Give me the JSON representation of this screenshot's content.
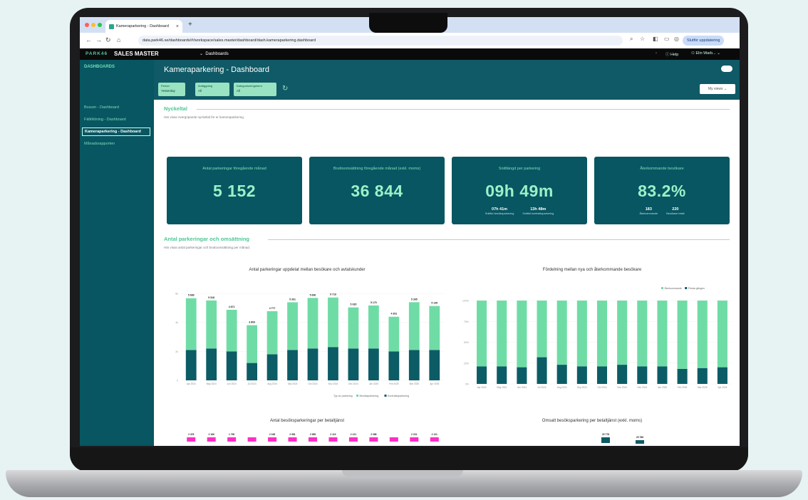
{
  "browser": {
    "tab_title": "Kameraparkering - Dashboard",
    "tab_close": "×",
    "new_tab": "+",
    "url": "data.park46.se/dashboards/#/workspace/sales.master/dashboard/dash.kameraparkering.dashboard",
    "update_button": "Slutför uppdatering"
  },
  "app": {
    "brand": "PARK46",
    "name": "SALES MASTER",
    "dashboards_menu": "Dashboards",
    "help": "Help",
    "user": "Elin Warb..."
  },
  "sidebar": {
    "header": "DASHBOARDS",
    "items": [
      {
        "label": "Bosum - Dashboard"
      },
      {
        "label": "Fältöktning - Dashboard"
      },
      {
        "label": "Kameraparkering - Dashboard"
      },
      {
        "label": "Månadsrapporten"
      }
    ]
  },
  "page": {
    "title": "Kameraparkering - Dashboard",
    "filters": [
      {
        "label": "Period",
        "value": "Yesterday"
      },
      {
        "label": "Anläggning",
        "value": "All"
      },
      {
        "label": "Kategoriseringsform",
        "value": "All"
      }
    ],
    "filter_right": "My views"
  },
  "section1": {
    "title": "Nyckeltal",
    "desc": "Här visas övergripande nyckeltal för er kameraparkering."
  },
  "kpis": [
    {
      "label": "Antal parkeringar föregående månad",
      "value": "5 152",
      "subs": []
    },
    {
      "label": "Bruttoomsättning föregående månad (exkl. moms)",
      "value": "36 844",
      "subs": []
    },
    {
      "label": "Snittlängd per parkering",
      "value": "09h 49m",
      "subs": [
        {
          "value": "07h 41m",
          "label": "Snitttid besöksparkering"
        },
        {
          "value": "13h 48m",
          "label": "Snitttid kontraktsparkering"
        }
      ]
    },
    {
      "label": "Återkommande besökare",
      "value": "83.2%",
      "subs": [
        {
          "value": "183",
          "label": "Återkommande"
        },
        {
          "value": "220",
          "label": "Besökare totalt"
        }
      ]
    }
  ],
  "section2": {
    "title": "Antal parkeringar och omsättning",
    "desc": "Här visas antal parkeringar och bruttoomsättning per månad."
  },
  "chart_data": [
    {
      "type": "bar",
      "title": "Antal parkeringar uppdelat mellan besökare och avtalskunder",
      "categories": [
        "Apr 2024",
        "May 2024",
        "Jun 2024",
        "Jul 2024",
        "Aug 2024",
        "Sep 2024",
        "Oct 2024",
        "Nov 2024",
        "Dec 2024",
        "Jan 2025",
        "Feb 2025",
        "Mar 2025",
        "Apr 2025"
      ],
      "total_labels": [
        "5 669",
        "5 518",
        "4 871",
        "3 809",
        "4 777",
        "5 391",
        "5 690",
        "5 719",
        "5 035",
        "5 170",
        "4 391",
        "5 395",
        "5 135"
      ],
      "series": [
        {
          "name": "Besöksparkering",
          "color": "#6fdca6",
          "values": [
            3569,
            3318,
            2871,
            2609,
            2977,
            3291,
            3490,
            3419,
            2835,
            2970,
            2391,
            3295,
            3035
          ]
        },
        {
          "name": "Kontraktsparkering",
          "color": "#0c5c66",
          "values": [
            2100,
            2200,
            2000,
            1200,
            1800,
            2100,
            2200,
            2300,
            2200,
            2200,
            2000,
            2100,
            2100
          ]
        }
      ],
      "legend_prefix": "Typ av parkering",
      "ylim": [
        0,
        6000
      ],
      "ytick_labels": [
        "0",
        "2k",
        "4k",
        "6k"
      ]
    },
    {
      "type": "bar",
      "title": "Fördelning mellan nya och återkommande besökare",
      "categories": [
        "Apr 2024",
        "May 2024",
        "Jun 2024",
        "Jul 2024",
        "Aug 2024",
        "Sep 2024",
        "Oct 2024",
        "Nov 2024",
        "Dec 2024",
        "Jan 2025",
        "Feb 2025",
        "Mar 2025",
        "Apr 2025"
      ],
      "series": [
        {
          "name": "Återkommande",
          "color": "#6fdca6",
          "values": [
            79,
            79,
            80,
            68,
            77,
            79,
            79,
            77,
            79,
            79,
            82,
            81,
            80
          ]
        },
        {
          "name": "Första gången",
          "color": "#0c5c66",
          "values": [
            21,
            21,
            20,
            32,
            23,
            21,
            21,
            23,
            21,
            21,
            18,
            19,
            20
          ]
        }
      ],
      "ylim": [
        0,
        100
      ],
      "ytick_labels": [
        "0%",
        "25%",
        "50%",
        "75%",
        "100%"
      ]
    },
    {
      "type": "bar",
      "title": "Antal besöksparkeringar per betaltjänst",
      "value_labels": [
        "2 478",
        "2 166",
        "1 790",
        "",
        "2 168",
        "2 981",
        "2 985",
        "2 113",
        "2 121",
        "2 088",
        "",
        "2 231",
        "2 121"
      ]
    },
    {
      "type": "bar",
      "title": "Omsatt besöksparkering per betaltjänst (exkl. moms)",
      "value_labels": [
        "20 778",
        "20 786"
      ]
    }
  ]
}
